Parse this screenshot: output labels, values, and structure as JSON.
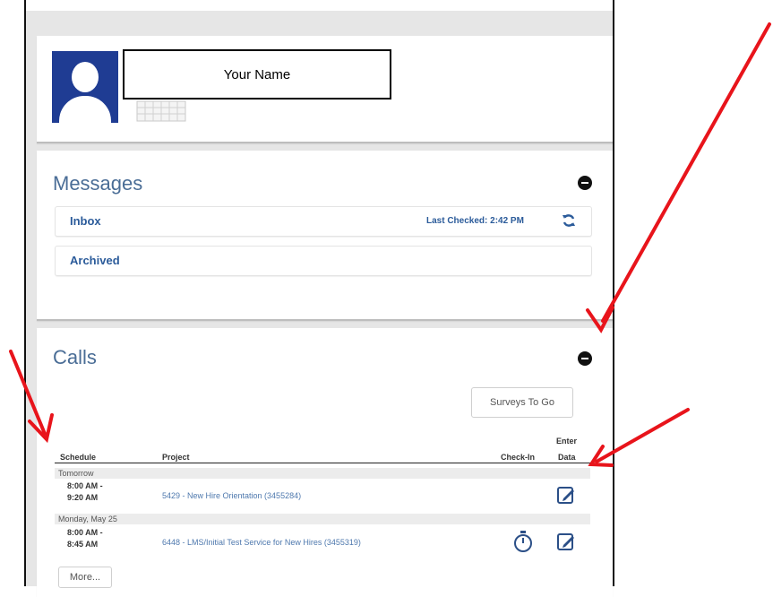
{
  "profile": {
    "name_placeholder": "Your Name",
    "avatar_icon": "user-avatar-icon",
    "keyboard_icon": "keyboard-icon"
  },
  "messages": {
    "title": "Messages",
    "inbox_label": "Inbox",
    "last_checked": "Last Checked: 2:42 PM",
    "archived_label": "Archived"
  },
  "calls": {
    "title": "Calls",
    "surveys_button": "Surveys To Go",
    "columns": {
      "schedule": "Schedule",
      "project": "Project",
      "checkin": "Check-In",
      "enter_data_1": "Enter",
      "enter_data_2": "Data"
    },
    "groups": [
      {
        "label": "Tomorrow",
        "rows": [
          {
            "time_start": "8:00 AM -",
            "time_end": "9:20 AM",
            "project": "5429 - New Hire Orientation (3455284)"
          }
        ]
      },
      {
        "label": "Monday, May 25",
        "rows": [
          {
            "time_start": "8:00 AM -",
            "time_end": "8:45 AM",
            "project": "6448 - LMS/Initial Test Service for New Hires (3455319)"
          }
        ]
      }
    ],
    "more_button": "More..."
  },
  "colors": {
    "annotation_arrow": "#e8141b",
    "link_blue": "#2b5b9a",
    "avatar_bg": "#1f3c93"
  }
}
